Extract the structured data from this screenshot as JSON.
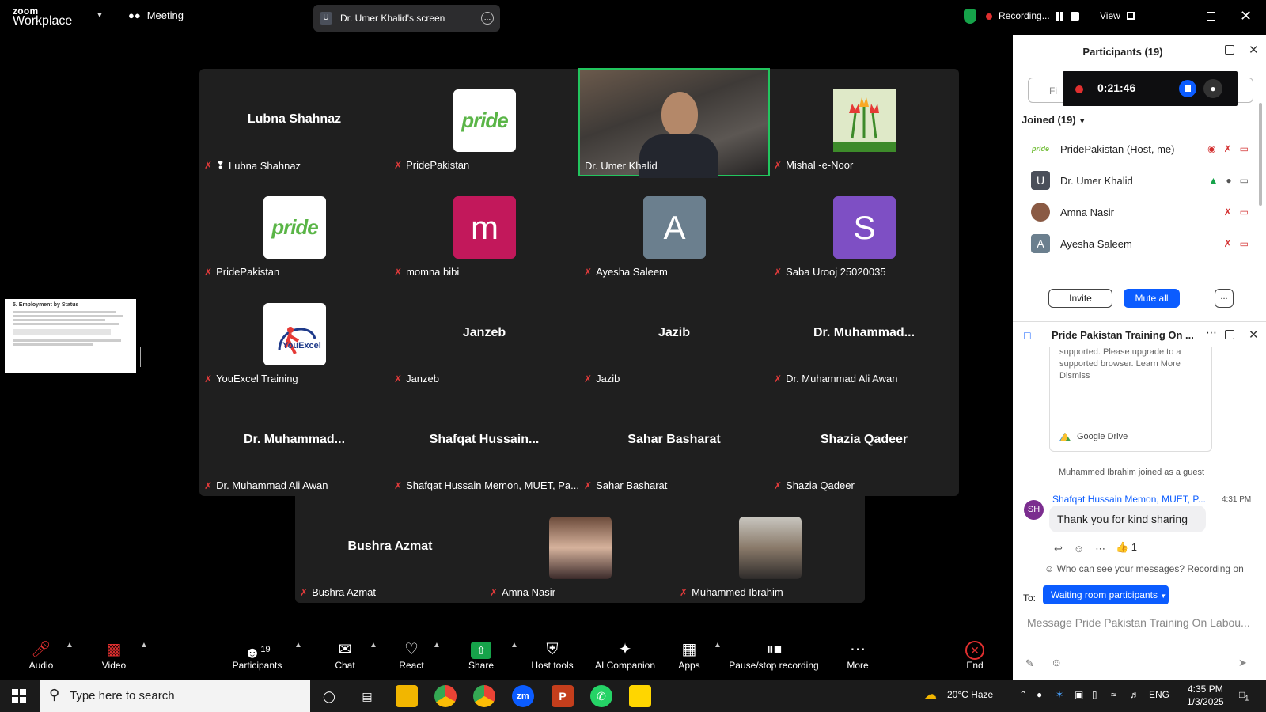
{
  "titlebar": {
    "logo_top": "zoom",
    "logo_bottom": "Workplace",
    "meeting_label": "Meeting",
    "screen_badge": "U",
    "screen_label": "Dr. Umer Khalid's screen",
    "recording_label": "Recording...",
    "view_label": "View"
  },
  "grid": {
    "tiles": [
      {
        "center": "Lubna Shahnaz",
        "label": "Lubna Shahnaz"
      },
      {
        "label": "PridePakistan"
      },
      {
        "label": "Dr. Umer Khalid"
      },
      {
        "label": "Mishal -e-Noor"
      },
      {
        "label": "PridePakistan"
      },
      {
        "avatar": "m",
        "label": "momna bibi"
      },
      {
        "avatar": "A",
        "label": "Ayesha Saleem"
      },
      {
        "avatar": "S",
        "label": "Saba Urooj 25020035"
      },
      {
        "logo": "YouExcel",
        "label": "YouExcel Training"
      },
      {
        "center": "Janzeb",
        "label": "Janzeb"
      },
      {
        "center": "Jazib",
        "label": "Jazib"
      },
      {
        "center": "Dr.  Muhammad...",
        "label": "Dr. Muhammad Ali Awan"
      },
      {
        "center": "Dr.  Muhammad...",
        "label": "Dr. Muhammad Ali Awan"
      },
      {
        "center": "Shafqat  Hussain...",
        "label": "Shafqat Hussain Memon, MUET, Pa..."
      },
      {
        "center": "Sahar Basharat",
        "label": "Sahar Basharat"
      },
      {
        "center": "Shazia Qadeer",
        "label": "Shazia Qadeer"
      },
      {
        "center": "Bushra Azmat",
        "label": "Bushra Azmat"
      },
      {
        "label": "Amna Nasir"
      },
      {
        "label": "Muhammed Ibrahim"
      }
    ],
    "pride_text": "pride"
  },
  "slide": {
    "title": "5. Employment by Status"
  },
  "participants": {
    "title": "Participants (19)",
    "search_placeholder": "Fi",
    "recording_time": "0:21:46",
    "joined_label": "Joined (19)",
    "rows": [
      {
        "avatar": "pride",
        "name": "PridePakistan (Host, me)"
      },
      {
        "avatar": "U",
        "name": "Dr. Umer Khalid"
      },
      {
        "avatar": "",
        "name": "Amna Nasir"
      },
      {
        "avatar": "A",
        "name": "Ayesha Saleem"
      }
    ],
    "invite_label": "Invite",
    "mute_all_label": "Mute all",
    "more_label": "..."
  },
  "chat": {
    "title": "Pride Pakistan Training On ...",
    "card_text": "supported. Please upgrade to a supported browser. Learn More Dismiss",
    "card_source": "Google Drive",
    "system_message": "Muhammed Ibrahim joined as a guest",
    "sender_initials": "SH",
    "sender": "Shafqat Hussain Memon, MUET, P...",
    "time": "4:31 PM",
    "message": "Thank you for kind sharing",
    "reaction": "👍 1",
    "visibility": "Who can see your messages? Recording on",
    "to_label": "To:",
    "to_value": "Waiting room participants",
    "input_placeholder": "Message Pride Pakistan Training On Labou..."
  },
  "toolbar": {
    "audio": "Audio",
    "video": "Video",
    "participants": "Participants",
    "participants_count": "19",
    "chat": "Chat",
    "react": "React",
    "share": "Share",
    "host_tools": "Host tools",
    "ai": "AI Companion",
    "apps": "Apps",
    "pause_stop": "Pause/stop recording",
    "more": "More",
    "end": "End"
  },
  "taskbar": {
    "search_placeholder": "Type here to search",
    "weather": "20°C  Haze",
    "lang": "ENG",
    "time": "4:35 PM",
    "date": "1/3/2025",
    "notif_count": "1"
  }
}
